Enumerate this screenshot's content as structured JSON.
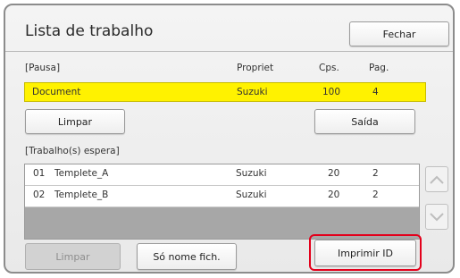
{
  "window": {
    "title": "Lista de trabalho",
    "close_label": "Fechar"
  },
  "paused": {
    "section_label": "[Pausa]",
    "columns": {
      "owner": "Propriet",
      "copies": "Cps.",
      "pages": "Pag."
    },
    "row": {
      "name": "Document",
      "owner": "Suzuki",
      "copies": "100",
      "pages": "4"
    },
    "clear_label": "Limpar",
    "exit_label": "Saída"
  },
  "waiting": {
    "section_label": "[Trabalho(s) espera]",
    "rows": [
      {
        "num": "01",
        "name": "Templete_A",
        "owner": "Suzuki",
        "copies": "20",
        "pages": "2"
      },
      {
        "num": "02",
        "name": "Templete_B",
        "owner": "Suzuki",
        "copies": "20",
        "pages": "2"
      }
    ]
  },
  "footer": {
    "clear_label": "Limpar",
    "filename_only_label": "Só nome fich.",
    "print_id_label": "Imprimir ID"
  },
  "colors": {
    "highlight_row": "#fff200",
    "callout_ring": "#e3001b",
    "empty_list": "#a7a7a7"
  },
  "icons": {
    "scroll_up": "chevron-up-icon",
    "scroll_down": "chevron-down-icon"
  }
}
